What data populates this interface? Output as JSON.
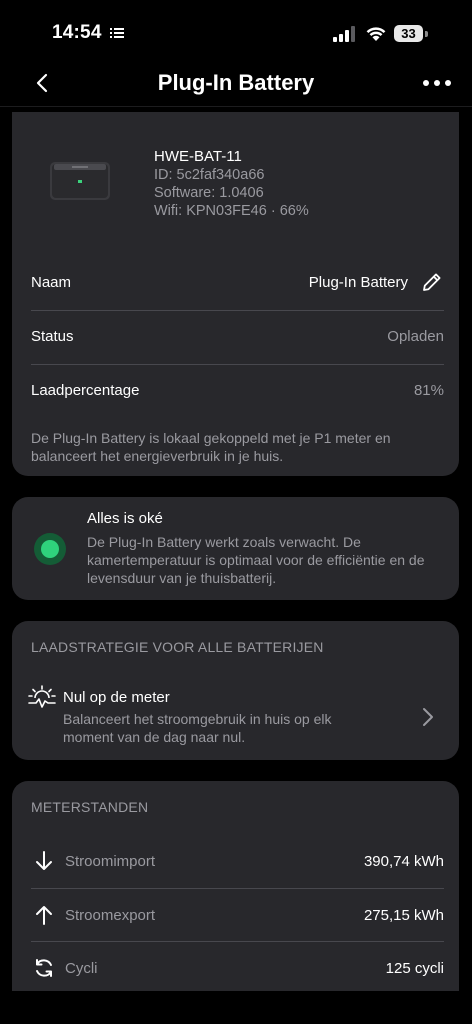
{
  "status_bar": {
    "time": "14:54",
    "battery_level": "33"
  },
  "nav": {
    "title": "Plug-In Battery",
    "back_icon": "chevron-left-icon",
    "more_icon": "ellipsis-icon"
  },
  "device": {
    "name": "HWE-BAT-11",
    "id": "ID: 5c2faf340a66",
    "software": "Software: 1.0406",
    "wifi": "Wifi: KPN03FE46 · 66%"
  },
  "details": {
    "name_label": "Naam",
    "name_value": "Plug-In Battery",
    "status_label": "Status",
    "status_value": "Opladen",
    "charge_label": "Laadpercentage",
    "charge_value": "81%",
    "description": "De Plug-In Battery is lokaal gekoppeld met je P1 meter en balanceert het energieverbruik in je huis."
  },
  "health": {
    "title": "Alles is oké",
    "description": "De Plug-In Battery werkt zoals verwacht. De kamertemperatuur is optimaal voor de efficiëntie en de levensduur van je thuisbatterij.",
    "dot_color": "#2fd27c"
  },
  "strategy": {
    "header": "LAADSTRATEGIE VOOR ALLE BATTERIJEN",
    "title": "Nul op de meter",
    "description": "Balanceert het stroomgebruik in huis op elk moment van de dag naar nul.",
    "icon": "sun-pulse-icon"
  },
  "meters": {
    "header": "METERSTANDEN",
    "rows": [
      {
        "label": "Stroomimport",
        "value": "390,74 kWh",
        "icon": "arrow-down-icon"
      },
      {
        "label": "Stroomexport",
        "value": "275,15 kWh",
        "icon": "arrow-up-icon"
      },
      {
        "label": "Cycli",
        "value": "125 cycli",
        "icon": "refresh-icon"
      }
    ]
  }
}
